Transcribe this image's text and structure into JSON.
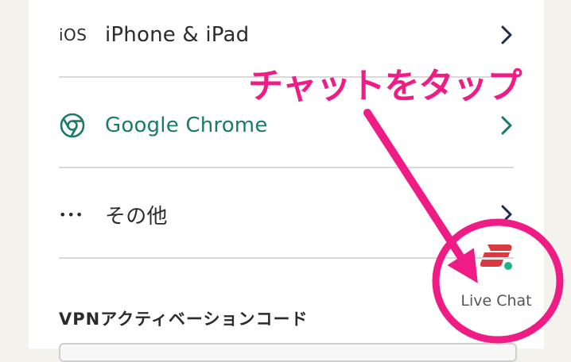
{
  "list": {
    "items": [
      {
        "icon": "ios-text",
        "icon_text": "iOS",
        "label": "iPhone & iPad"
      },
      {
        "icon": "chrome-icon",
        "label": "Google Chrome"
      },
      {
        "icon": "more-dots-icon",
        "icon_text": "•••",
        "label": "その他"
      }
    ]
  },
  "section": {
    "title": "VPNアクティベーションコード"
  },
  "annotation": {
    "text": "チャットをタップ"
  },
  "live_chat": {
    "label": "Live Chat"
  },
  "colors": {
    "annotation": "#f01c86",
    "chrome_green": "#1b7a6b",
    "brand_red": "#da3940",
    "status_dot": "#20b28b"
  }
}
